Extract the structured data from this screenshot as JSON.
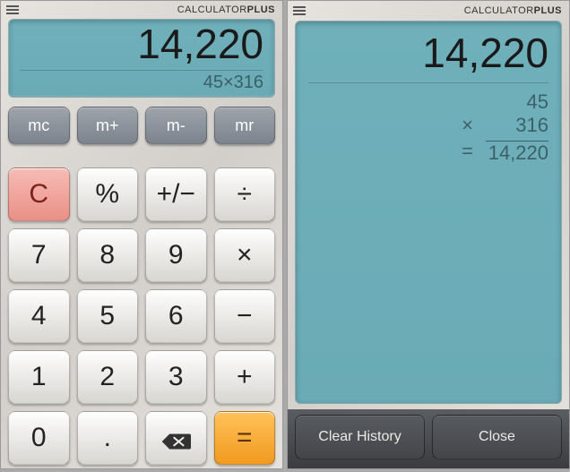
{
  "brand": {
    "light": "CALCULATOR",
    "bold": "PLUS"
  },
  "left": {
    "display_value": "14,220",
    "display_expression": "45×316",
    "buttons": {
      "mc": "mc",
      "mplus": "m+",
      "mminus": "m-",
      "mr": "mr",
      "clear": "C",
      "percent": "%",
      "sign": "+/−",
      "divide": "÷",
      "d7": "7",
      "d8": "8",
      "d9": "9",
      "multiply": "×",
      "d4": "4",
      "d5": "5",
      "d6": "6",
      "minus": "−",
      "d1": "1",
      "d2": "2",
      "d3": "3",
      "plus": "+",
      "d0": "0",
      "dot": ".",
      "equals": "="
    }
  },
  "right": {
    "display_value": "14,220",
    "history": {
      "operand1": "45",
      "operator": "×",
      "operand2": "316",
      "equal_sign": "=",
      "result": "14,220"
    },
    "buttons": {
      "clear_history": "Clear History",
      "close": "Close"
    }
  }
}
